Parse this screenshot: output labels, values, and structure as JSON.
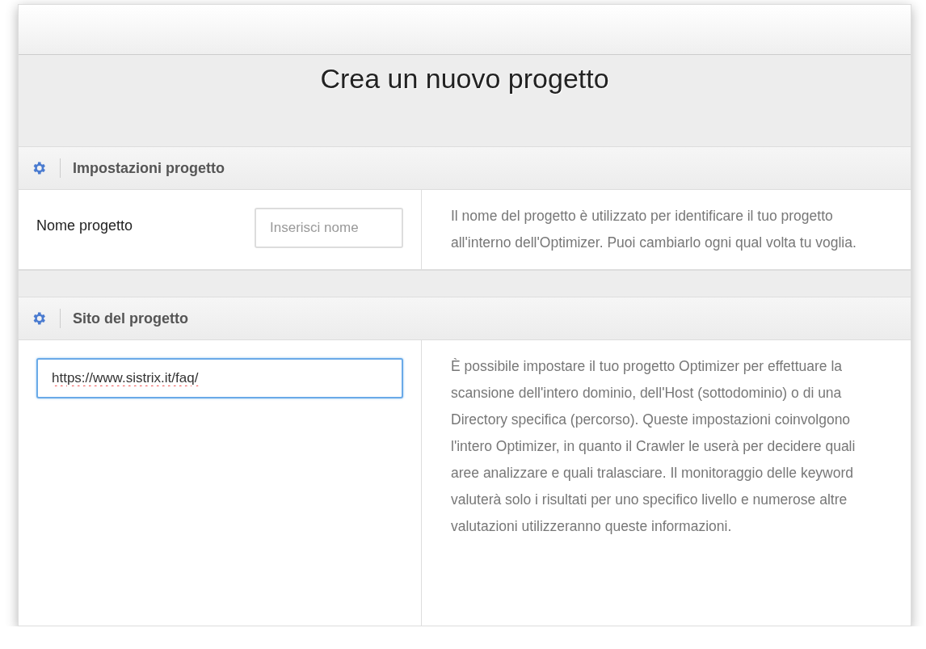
{
  "title": "Crea un nuovo progetto",
  "sections": [
    {
      "heading": "Impostazioni progetto",
      "kind": "labeled",
      "label": "Nome progetto",
      "field": {
        "placeholder": "Inserisci nome",
        "focused": false,
        "spellcheck_marked": false
      },
      "description": "Il nome del progetto è utilizzato per identificare il tuo progetto all'interno dell'Optimizer. Puoi cambiarlo ogni qual volta tu voglia."
    },
    {
      "heading": "Sito del progetto",
      "kind": "wide",
      "field": {
        "value": "https://www.sistrix.it/faq/",
        "focused": true,
        "spellcheck_marked": true
      },
      "description": "È possibile impostare il tuo progetto Optimizer per effettuare la scansione dell'intero dominio, dell'Host (sottodominio) o di una Directory specifica (percorso). Queste impostazioni coinvolgono l'intero Optimizer, in quanto il Crawler le userà per decidere quali aree analizzare e quali tralasciare. Il monitoraggio delle keyword valuterà solo i risultati per uno specifico livello e numerose altre valutazioni utilizzeranno queste informazioni."
    }
  ]
}
